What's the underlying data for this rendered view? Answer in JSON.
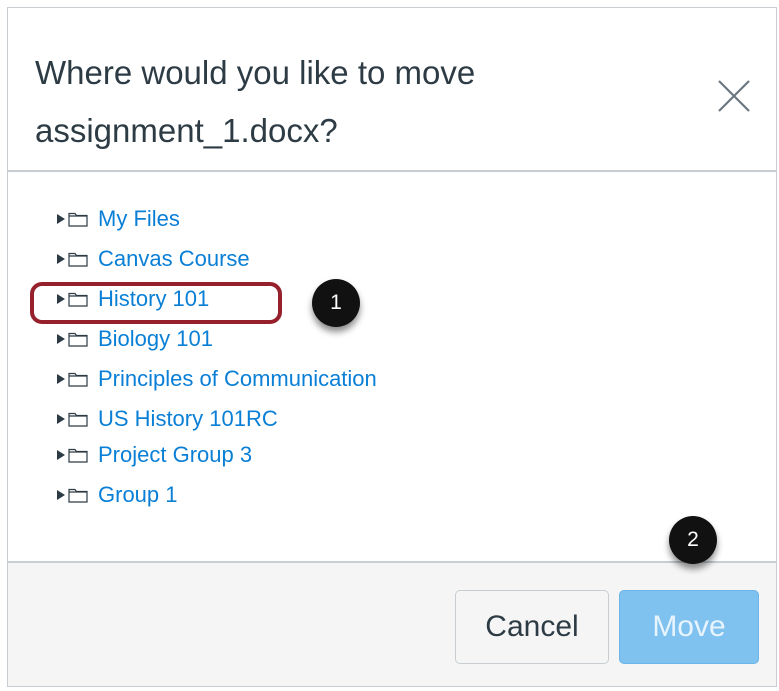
{
  "dialog": {
    "title": "Where would you like to move assignment_1.docx?",
    "close_icon": "close-icon"
  },
  "tree": {
    "items": [
      {
        "label": "My Files",
        "icon": "folder-icon",
        "toggle": "expand-arrow-icon"
      },
      {
        "label": "Canvas Course",
        "icon": "folder-icon",
        "toggle": "expand-arrow-icon"
      },
      {
        "label": "History 101",
        "icon": "folder-icon",
        "toggle": "expand-arrow-icon"
      },
      {
        "label": "Biology 101",
        "icon": "folder-icon",
        "toggle": "expand-arrow-icon"
      },
      {
        "label": "Principles of Communication",
        "icon": "folder-icon",
        "toggle": "expand-arrow-icon"
      },
      {
        "label": "US History 101RC",
        "icon": "folder-icon",
        "toggle": "expand-arrow-icon"
      },
      {
        "label": "Project Group 3",
        "icon": "folder-icon",
        "toggle": "expand-arrow-icon"
      },
      {
        "label": "Group 1",
        "icon": "folder-icon",
        "toggle": "expand-arrow-icon"
      }
    ]
  },
  "callouts": {
    "first": "1",
    "second": "2"
  },
  "footer": {
    "cancel_label": "Cancel",
    "move_label": "Move"
  },
  "colors": {
    "link": "#0a7fd6",
    "highlight": "#96202b",
    "primary_disabled": "#7fc2f0",
    "text": "#2d3b45"
  }
}
